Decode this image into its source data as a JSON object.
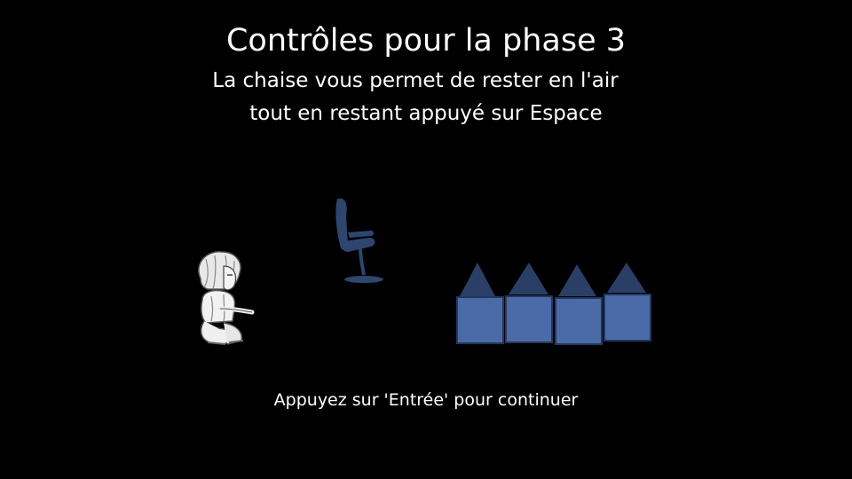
{
  "screen": {
    "title": "Contrôles pour la phase 3",
    "instruction_line1": "La chaise vous permet de rester en l'air",
    "instruction_line2": "tout en restant appuyé sur Espace",
    "continue_prompt": "Appuyez sur 'Entrée' pour continuer"
  },
  "sprites": {
    "player": "player-character-sprite",
    "chair": "office-chair-icon",
    "obstacle": "spike-block-obstacle",
    "obstacle_count": 4
  },
  "colors": {
    "background": "#000000",
    "text": "#ffffff",
    "block_fill": "#4a6aa8",
    "block_border": "#22385e",
    "spike_fill": "#2a3f66",
    "chair_fill": "#2d4670"
  }
}
